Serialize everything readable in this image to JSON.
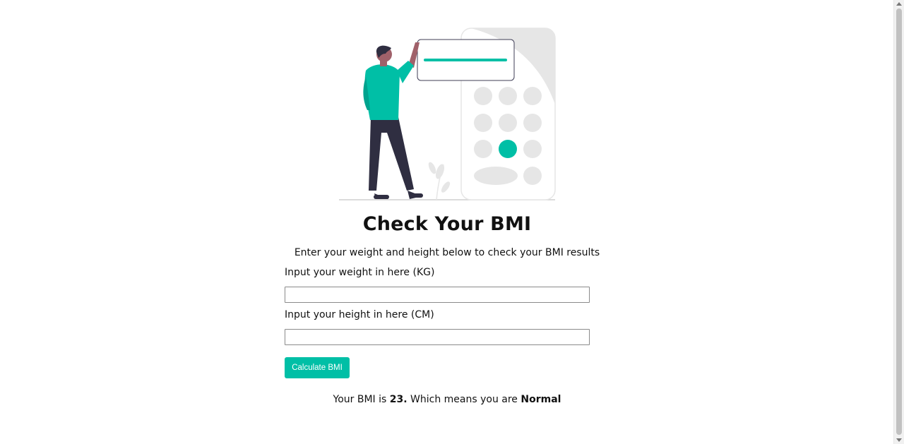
{
  "hero": {
    "title": "Check Your BMI",
    "subtitle": "Enter your weight and height below to check your BMI results"
  },
  "form": {
    "weight_label": "Input your weight in here (KG)",
    "weight_value": "",
    "height_label": "Input your height in here (CM)",
    "height_value": "",
    "calculate_label": "Calculate BMI"
  },
  "result": {
    "prefix": "Your BMI is ",
    "bmi_value": "23.",
    "middle": " Which means you are ",
    "category": "Normal"
  },
  "colors": {
    "accent": "#00bfa6",
    "dark": "#2f2e41",
    "light_gray": "#e6e6e6"
  }
}
